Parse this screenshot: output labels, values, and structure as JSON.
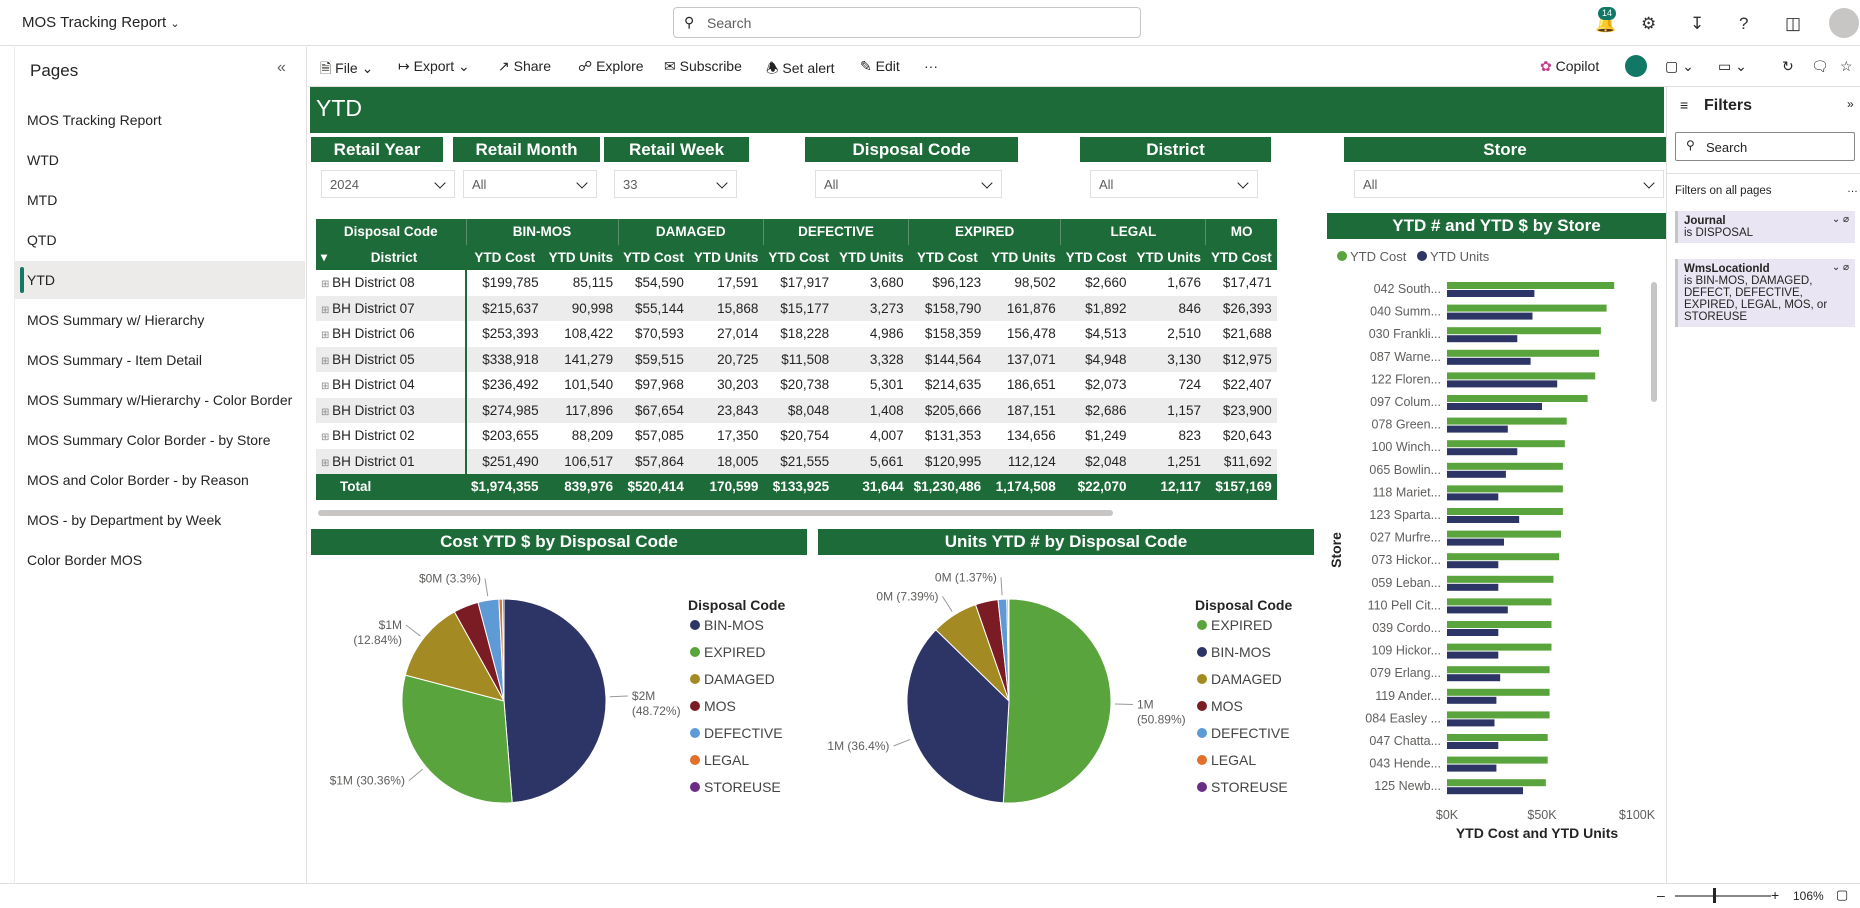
{
  "app": {
    "title": "MOS Tracking Report",
    "search_placeholder": "Search",
    "notifications": "14"
  },
  "pages": {
    "title": "Pages",
    "items": [
      "MOS Tracking Report",
      "WTD",
      "MTD",
      "QTD",
      "YTD",
      "MOS Summary w/ Hierarchy",
      "MOS Summary - Item Detail",
      "MOS Summary w/Hierarchy - Color Border",
      "MOS Summary Color Border - by Store",
      "MOS and Color Border - by Reason",
      "MOS - by Department by Week",
      "Color Border MOS"
    ],
    "selected": "YTD"
  },
  "toolbar": {
    "file": "File",
    "export": "Export",
    "share": "Share",
    "explore": "Explore",
    "subscribe": "Subscribe",
    "set_alert": "Set alert",
    "edit": "Edit",
    "more": "···",
    "copilot": "Copilot"
  },
  "report": {
    "title": "YTD"
  },
  "slicers": [
    {
      "label": "Retail Year",
      "value": "2024"
    },
    {
      "label": "Retail Month",
      "value": "All"
    },
    {
      "label": "Retail Week",
      "value": "33"
    },
    {
      "label": "Disposal Code",
      "value": "All"
    },
    {
      "label": "District",
      "value": "All"
    },
    {
      "label": "Store",
      "value": "All"
    }
  ],
  "matrix": {
    "row_header_top": "Disposal Code",
    "row_header": "District",
    "groups": [
      "BIN-MOS",
      "DAMAGED",
      "DEFECTIVE",
      "EXPIRED",
      "LEGAL",
      "MO"
    ],
    "sub": [
      "YTD Cost",
      "YTD Units"
    ],
    "rows": [
      {
        "name": "BH District 08",
        "v": [
          "$199,785",
          "85,115",
          "$54,590",
          "17,591",
          "$17,917",
          "3,680",
          "$96,123",
          "98,502",
          "$2,660",
          "1,676",
          "$17,471"
        ]
      },
      {
        "name": "BH District 07",
        "v": [
          "$215,637",
          "90,998",
          "$55,144",
          "15,868",
          "$15,177",
          "3,273",
          "$158,790",
          "161,876",
          "$1,892",
          "846",
          "$26,393"
        ]
      },
      {
        "name": "BH District 06",
        "v": [
          "$253,393",
          "108,422",
          "$70,593",
          "27,014",
          "$18,228",
          "4,986",
          "$158,359",
          "156,478",
          "$4,513",
          "2,510",
          "$21,688"
        ]
      },
      {
        "name": "BH District 05",
        "v": [
          "$338,918",
          "141,279",
          "$59,515",
          "20,725",
          "$11,508",
          "3,328",
          "$144,564",
          "137,071",
          "$4,948",
          "3,130",
          "$12,975"
        ]
      },
      {
        "name": "BH District 04",
        "v": [
          "$236,492",
          "101,540",
          "$97,968",
          "30,203",
          "$20,738",
          "5,301",
          "$214,635",
          "186,651",
          "$2,073",
          "724",
          "$22,407"
        ]
      },
      {
        "name": "BH District 03",
        "v": [
          "$274,985",
          "117,896",
          "$67,654",
          "23,843",
          "$8,048",
          "1,408",
          "$205,666",
          "187,151",
          "$2,686",
          "1,157",
          "$23,900"
        ]
      },
      {
        "name": "BH District 02",
        "v": [
          "$203,655",
          "88,209",
          "$57,085",
          "17,350",
          "$20,754",
          "4,007",
          "$131,353",
          "134,656",
          "$1,249",
          "823",
          "$20,643"
        ]
      },
      {
        "name": "BH District 01",
        "v": [
          "$251,490",
          "106,517",
          "$57,864",
          "18,005",
          "$21,555",
          "5,661",
          "$120,995",
          "112,124",
          "$2,048",
          "1,251",
          "$11,692"
        ]
      }
    ],
    "total": {
      "name": "Total",
      "v": [
        "$1,974,355",
        "839,976",
        "$520,414",
        "170,599",
        "$133,925",
        "31,644",
        "$1,230,486",
        "1,174,508",
        "$22,070",
        "12,117",
        "$157,169"
      ]
    }
  },
  "chart_data": [
    {
      "type": "pie",
      "title": "Cost YTD $ by Disposal Code",
      "legend_title": "Disposal Code",
      "slices": [
        {
          "name": "BIN-MOS",
          "value": 48.72,
          "color": "#2c3566",
          "label": "$2M",
          "pct_label": "(48.72%)"
        },
        {
          "name": "EXPIRED",
          "value": 30.36,
          "color": "#59a43c",
          "label": "$1M (30.36%)"
        },
        {
          "name": "DAMAGED",
          "value": 12.84,
          "color": "#a48a22",
          "label": "$1M",
          "pct_label": "(12.84%)"
        },
        {
          "name": "MOS",
          "value": 3.98,
          "color": "#7b1c25",
          "label": ""
        },
        {
          "name": "DEFECTIVE",
          "value": 3.3,
          "color": "#5e9ad6",
          "label": "$0M (3.3%)"
        },
        {
          "name": "LEGAL",
          "value": 0.55,
          "color": "#e0702a",
          "label": ""
        },
        {
          "name": "STOREUSE",
          "value": 0.25,
          "color": "#6b2c86",
          "label": ""
        }
      ]
    },
    {
      "type": "pie",
      "title": "Units YTD # by Disposal Code",
      "legend_title": "Disposal Code",
      "slices": [
        {
          "name": "EXPIRED",
          "value": 50.89,
          "color": "#59a43c",
          "label": "1M",
          "pct_label": "(50.89%)"
        },
        {
          "name": "BIN-MOS",
          "value": 36.4,
          "color": "#2c3566",
          "label": "1M (36.4%)"
        },
        {
          "name": "DAMAGED",
          "value": 7.39,
          "color": "#a48a22",
          "label": "0M (7.39%)"
        },
        {
          "name": "MOS",
          "value": 3.6,
          "color": "#7b1c25",
          "label": ""
        },
        {
          "name": "DEFECTIVE",
          "value": 1.37,
          "color": "#5e9ad6",
          "label": "0M (1.37%)"
        },
        {
          "name": "LEGAL",
          "value": 0.25,
          "color": "#e0702a",
          "label": ""
        },
        {
          "name": "STOREUSE",
          "value": 0.1,
          "color": "#6b2c86",
          "label": ""
        }
      ]
    },
    {
      "type": "bar",
      "orientation": "horizontal",
      "title": "YTD # and YTD $ by Store",
      "xlabel": "YTD Cost and YTD Units",
      "ylabel": "Store",
      "xlim": [
        0,
        100000
      ],
      "x_ticks": [
        "$0K",
        "$50K",
        "$100K"
      ],
      "categories": [
        "042 South...",
        "040 Summ...",
        "030 Frankli...",
        "087 Warne...",
        "122 Floren...",
        "097 Colum...",
        "078 Green...",
        "100 Winch...",
        "065 Bowlin...",
        "118 Mariet...",
        "123 Sparta...",
        "027 Murfre...",
        "073 Hickor...",
        "059 Leban...",
        "110 Pell Cit...",
        "039 Cordo...",
        "109 Hickor...",
        "079 Erlang...",
        "119 Ander...",
        "084 Easley ...",
        "047 Chatta...",
        "043 Hende...",
        "125 Newb..."
      ],
      "series": [
        {
          "name": "YTD Cost",
          "color": "#59a43c",
          "values": [
            88000,
            84000,
            81000,
            80000,
            78000,
            74000,
            63000,
            62000,
            61000,
            61000,
            61000,
            60000,
            59000,
            56000,
            55000,
            55000,
            55000,
            54000,
            54000,
            54000,
            53000,
            53000,
            52000
          ]
        },
        {
          "name": "YTD Units",
          "color": "#2c3566",
          "values": [
            46000,
            45000,
            37000,
            44000,
            58000,
            50000,
            32000,
            37000,
            31000,
            27000,
            38000,
            30000,
            27000,
            27000,
            32000,
            27000,
            27000,
            28000,
            26000,
            25000,
            27000,
            26000,
            40000
          ]
        }
      ]
    }
  ],
  "filters": {
    "title": "Filters",
    "search": "Search",
    "section": "Filters on all pages",
    "cards": [
      {
        "field": "Journal",
        "cond": "is DISPOSAL"
      },
      {
        "field": "WmsLocationId",
        "cond": "is BIN-MOS, DAMAGED, DEFECT, DEFECTIVE, EXPIRED, LEGAL, MOS, or STOREUSE"
      }
    ]
  },
  "status": {
    "zoom": "106%"
  }
}
